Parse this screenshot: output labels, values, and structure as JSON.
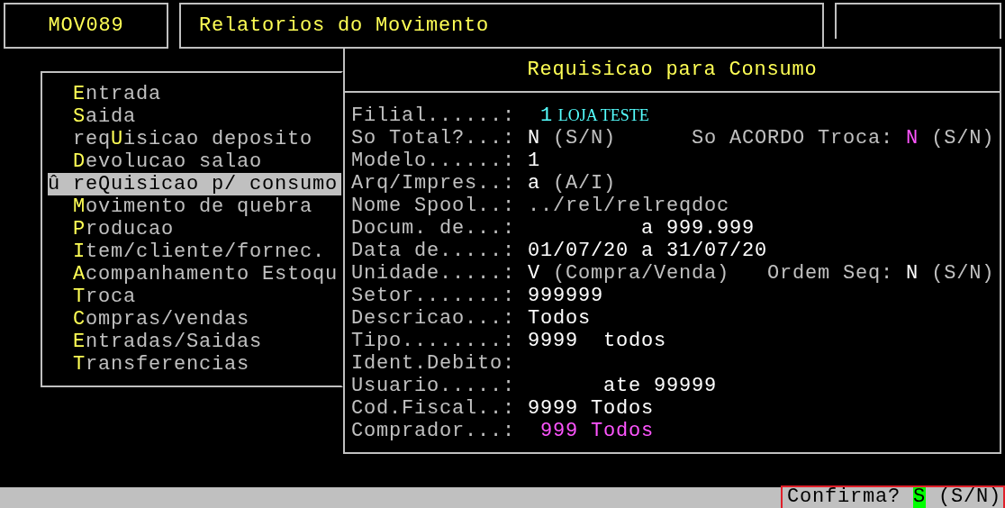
{
  "header": {
    "program_code": "MOV089",
    "title": "Relatorios do Movimento"
  },
  "menu": {
    "cursor": "û",
    "items": [
      {
        "key": "E",
        "after": "ntrada",
        "selected": false
      },
      {
        "key": "S",
        "after": "aida",
        "selected": false
      },
      {
        "before": "req",
        "key": "U",
        "after": "isicao deposito",
        "selected": false
      },
      {
        "key": "D",
        "after": "evolucao salao",
        "selected": false
      },
      {
        "before": "re",
        "key": "Q",
        "after": "uisicao p/ consumo",
        "selected": true
      },
      {
        "key": "M",
        "after": "ovimento de quebra",
        "selected": false
      },
      {
        "key": "P",
        "after": "roducao",
        "selected": false
      },
      {
        "key": "I",
        "after": "tem/cliente/fornec.",
        "selected": false
      },
      {
        "key": "A",
        "after": "companhamento Estoqu",
        "selected": false
      },
      {
        "key": "T",
        "after": "roca",
        "selected": false
      },
      {
        "key": "C",
        "after": "ompras/vendas",
        "selected": false
      },
      {
        "key": "E",
        "after": "ntradas/Saidas",
        "selected": false
      },
      {
        "key": "T",
        "after": "ransferencias",
        "selected": false
      }
    ]
  },
  "form": {
    "title": "Requisicao para Consumo",
    "fields": [
      {
        "label": "Filial......:",
        "parts": [
          {
            "text": "1",
            "color": "#55ffff",
            "kind": "mono"
          },
          {
            "text": "LOJA TESTE",
            "color": "#55ffff",
            "kind": "proportional"
          }
        ]
      },
      {
        "label": "So Total?...:",
        "parts": [
          {
            "text": "N",
            "color": "#ffffff",
            "kind": "mono"
          },
          {
            "text": "(S/N)",
            "color": "#c0c0c0",
            "kind": "mono"
          },
          {
            "text": "So ACORDO Troca:",
            "color": "#c0c0c0",
            "kind": "mono"
          },
          {
            "text": "N",
            "color": "#ff55ff",
            "kind": "mono"
          },
          {
            "text": "(S/N)",
            "color": "#c0c0c0",
            "kind": "mono"
          }
        ]
      },
      {
        "label": "Modelo......:",
        "parts": [
          {
            "text": "1",
            "color": "#ffffff",
            "kind": "mono"
          }
        ]
      },
      {
        "label": "Arq/Impres..:",
        "parts": [
          {
            "text": "a",
            "color": "#ffffff",
            "kind": "mono"
          },
          {
            "text": "(A/I)",
            "color": "#c0c0c0",
            "kind": "mono"
          }
        ]
      },
      {
        "label": "Nome Spool..:",
        "parts": [
          {
            "text": "../rel/relreqdoc",
            "color": "#c0c0c0",
            "kind": "mono"
          }
        ]
      },
      {
        "label": "Docum. de...:",
        "parts": [
          {
            "text": "a 999.999",
            "color": "#ffffff",
            "kind": "mono"
          }
        ]
      },
      {
        "label": "Data de.....:",
        "parts": [
          {
            "text": "01/07/20 a 31/07/20",
            "color": "#ffffff",
            "kind": "mono"
          }
        ]
      },
      {
        "label": "Unidade.....:",
        "parts": [
          {
            "text": "V",
            "color": "#ffffff",
            "kind": "mono"
          },
          {
            "text": "(Compra/Venda)",
            "color": "#c0c0c0",
            "kind": "mono"
          },
          {
            "text": "Ordem Seq:",
            "color": "#c0c0c0",
            "kind": "mono"
          },
          {
            "text": "N",
            "color": "#ffffff",
            "kind": "mono"
          },
          {
            "text": "(S/N)",
            "color": "#c0c0c0",
            "kind": "mono"
          }
        ]
      },
      {
        "label": "Setor.......:",
        "parts": [
          {
            "text": "999999",
            "color": "#ffffff",
            "kind": "mono"
          }
        ]
      },
      {
        "label": "Descricao...:",
        "parts": [
          {
            "text": "Todos",
            "color": "#ffffff",
            "kind": "mono"
          }
        ]
      },
      {
        "label": "Tipo........:",
        "parts": [
          {
            "text": "9999",
            "color": "#ffffff",
            "kind": "mono"
          },
          {
            "text": "todos",
            "color": "#ffffff",
            "kind": "mono"
          }
        ]
      },
      {
        "label": "Ident.Debito:"
      },
      {
        "label": "Usuario.....:",
        "parts": [
          {
            "text": "ate 99999",
            "color": "#ffffff",
            "kind": "mono"
          }
        ]
      },
      {
        "label": "Cod.Fiscal..:",
        "parts": [
          {
            "text": "9999 Todos",
            "color": "#ffffff",
            "kind": "mono"
          }
        ]
      },
      {
        "label": "Comprador...:",
        "parts": [
          {
            "text": "999",
            "color": "#ff55ff",
            "kind": "mono"
          },
          {
            "text": "Todos",
            "color": "#ff55ff",
            "kind": "mono"
          }
        ]
      }
    ]
  },
  "status_bar": {
    "prompt": "Confirma?",
    "answer": "S",
    "hint": "(S/N)"
  }
}
